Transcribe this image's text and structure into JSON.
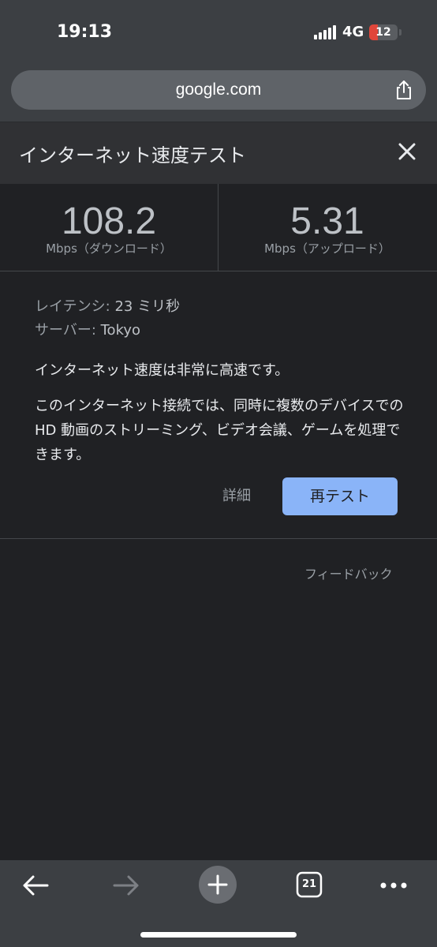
{
  "status": {
    "time": "19:13",
    "network": "4G",
    "battery": "12",
    "battery_level": 0.12
  },
  "browser": {
    "url": "google.com"
  },
  "panel": {
    "title": "インターネット速度テスト",
    "download": {
      "value": "108.2",
      "label": "Mbps（ダウンロード）"
    },
    "upload": {
      "value": "5.31",
      "label": "Mbps（アップロード）"
    },
    "latency_label": "レイテンシ:",
    "latency_value": "23 ミリ秒",
    "server_label": "サーバー:",
    "server_value": "Tokyo",
    "summary": "インターネット速度は非常に高速です。",
    "description": "このインターネット接続では、同時に複数のデバイスでの HD 動画のストリーミング、ビデオ会議、ゲームを処理できます。",
    "details_button": "詳細",
    "retest_button": "再テスト",
    "feedback": "フィードバック"
  },
  "toolbar": {
    "tab_count": "21"
  },
  "icons": [
    "back-icon",
    "forward-icon",
    "new-tab-icon",
    "tabs-icon",
    "more-icon",
    "share-icon",
    "close-icon",
    "signal-icon",
    "battery-icon"
  ]
}
